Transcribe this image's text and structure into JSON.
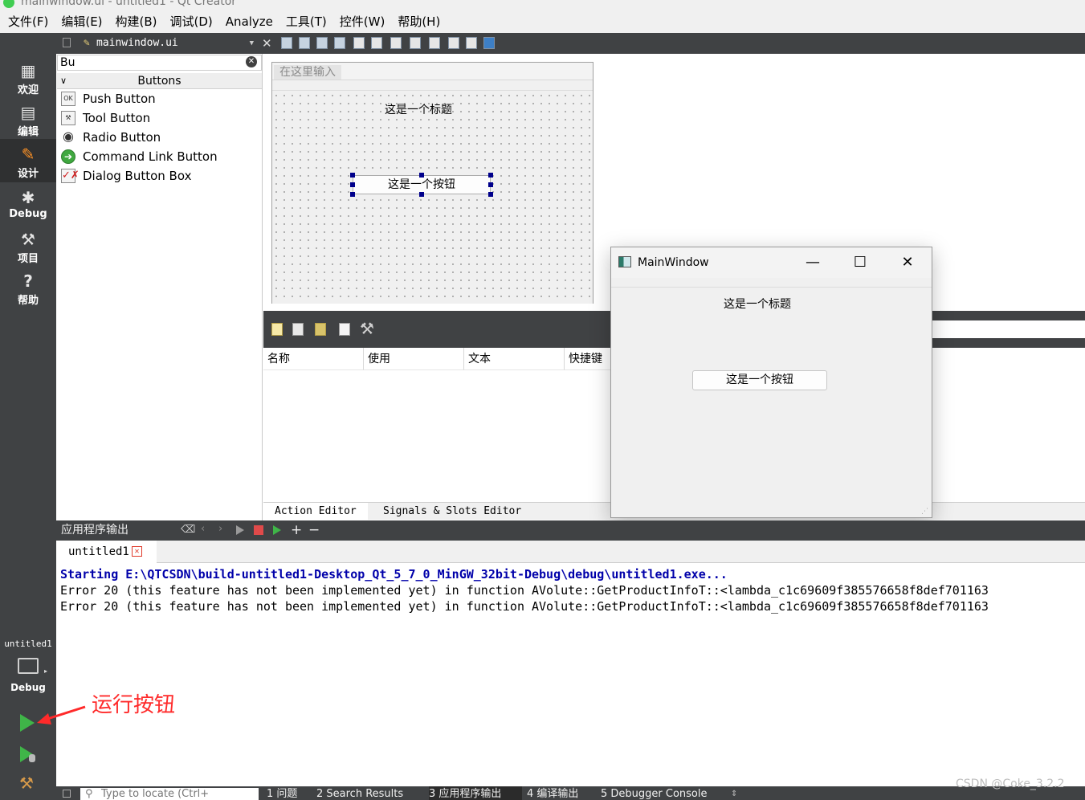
{
  "window": {
    "title": "mainwindow.ui - untitled1 - Qt Creator"
  },
  "menus": [
    "文件(F)",
    "编辑(E)",
    "构建(B)",
    "调试(D)",
    "Analyze",
    "工具(T)",
    "控件(W)",
    "帮助(H)"
  ],
  "modes": [
    {
      "label": "欢迎",
      "icon": "grid-icon"
    },
    {
      "label": "编辑",
      "icon": "document-icon"
    },
    {
      "label": "设计",
      "icon": "pencil-icon"
    },
    {
      "label": "Debug",
      "icon": "bug-icon"
    },
    {
      "label": "项目",
      "icon": "wrench-icon"
    },
    {
      "label": "帮助",
      "icon": "help-icon"
    }
  ],
  "document": {
    "file": "mainwindow.ui"
  },
  "widget_box": {
    "filter_value": "Bu",
    "category": "Buttons",
    "items": [
      "Push Button",
      "Tool Button",
      "Radio Button",
      "Command Link Button",
      "Dialog Button Box"
    ]
  },
  "form": {
    "menu_placeholder": "在这里输入",
    "label_text": "这是一个标题",
    "button_text": "这是一个按钮"
  },
  "action_editor": {
    "columns": [
      "名称",
      "使用",
      "文本",
      "快捷键"
    ],
    "tabs": [
      "Action Editor",
      "Signals & Slots Editor"
    ]
  },
  "running_window": {
    "title": "MainWindow",
    "label_text": "这是一个标题",
    "button_text": "这是一个按钮",
    "controls": {
      "minimize": "—",
      "maximize": "☐",
      "close": "✕"
    }
  },
  "output": {
    "pane_title": "应用程序输出",
    "tab": "untitled1",
    "lines": [
      "Starting E:\\QTCSDN\\build-untitled1-Desktop_Qt_5_7_0_MinGW_32bit-Debug\\debug\\untitled1.exe...",
      "Error 20 (this feature has not been implemented yet) in function AVolute::GetProductInfoT::<lambda_c1c69609f385576658f8def701163",
      "Error 20 (this feature has not been implemented yet) in function AVolute::GetProductInfoT::<lambda_c1c69609f385576658f8def701163"
    ]
  },
  "kit": {
    "project": "untitled1",
    "config": "Debug"
  },
  "statusbar": {
    "locator_placeholder": "Type to locate (Ctrl+",
    "items": [
      "1 问题",
      "2 Search Results",
      "3 应用程序输出",
      "4 编译输出",
      "5 Debugger Console"
    ]
  },
  "annotation": {
    "text": "运行按钮"
  },
  "watermark": "CSDN @Coke_3.2.2",
  "colors": {
    "annotation": "#ff2a2a",
    "active_mode": "#ff9326",
    "run_green": "#3fb548",
    "start_text": "#0000aa"
  }
}
